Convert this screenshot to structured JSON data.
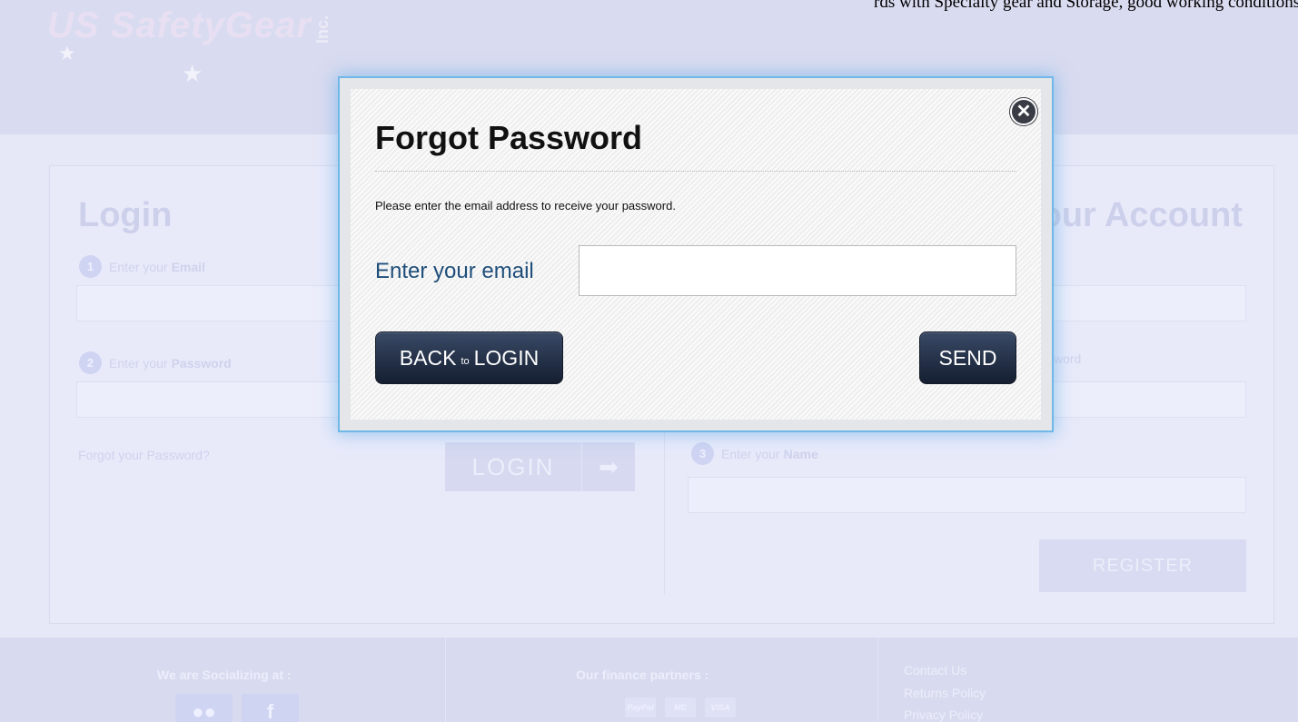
{
  "top_right_snippet": "rds with Specialty gear and Storage, good working conditions fo",
  "logo": {
    "brand": "US SafetyGear",
    "suffix": "Inc."
  },
  "login": {
    "heading": "Login",
    "step1_num": "1",
    "step1_prefix": "Enter your",
    "step1_field": "Email",
    "step2_num": "2",
    "step2_prefix": "Enter your",
    "step2_field": "Password",
    "forgot_link": "Forgot your Password?",
    "button": "LOGIN",
    "button_arrow": "➡"
  },
  "register": {
    "heading": "Create your Account",
    "step2_partial": "word",
    "step3_num": "3",
    "step3_prefix": "Enter your",
    "step3_field": "Name",
    "button": "REGISTER"
  },
  "footer": {
    "social_title": "We are Socializing at :",
    "social_icons": [
      "flickr-icon",
      "facebook-icon"
    ],
    "social_glyph_1": "●●",
    "social_glyph_2": "f",
    "finance_title": "Our finance partners :",
    "pay_1": "PayPal",
    "pay_2": "MC",
    "pay_3": "VISA",
    "links": [
      "Contact Us",
      "Returns Policy",
      "Privacy Policy"
    ]
  },
  "modal": {
    "close_glyph": "✕",
    "title": "Forgot Password",
    "description": "Please enter the email address to receive your password.",
    "email_label": "Enter your email",
    "email_value": "",
    "back_prefix": "BACK",
    "back_small": "to",
    "back_suffix": "LOGIN",
    "send_label": "SEND",
    "accent_color": "#6fb8e8"
  }
}
